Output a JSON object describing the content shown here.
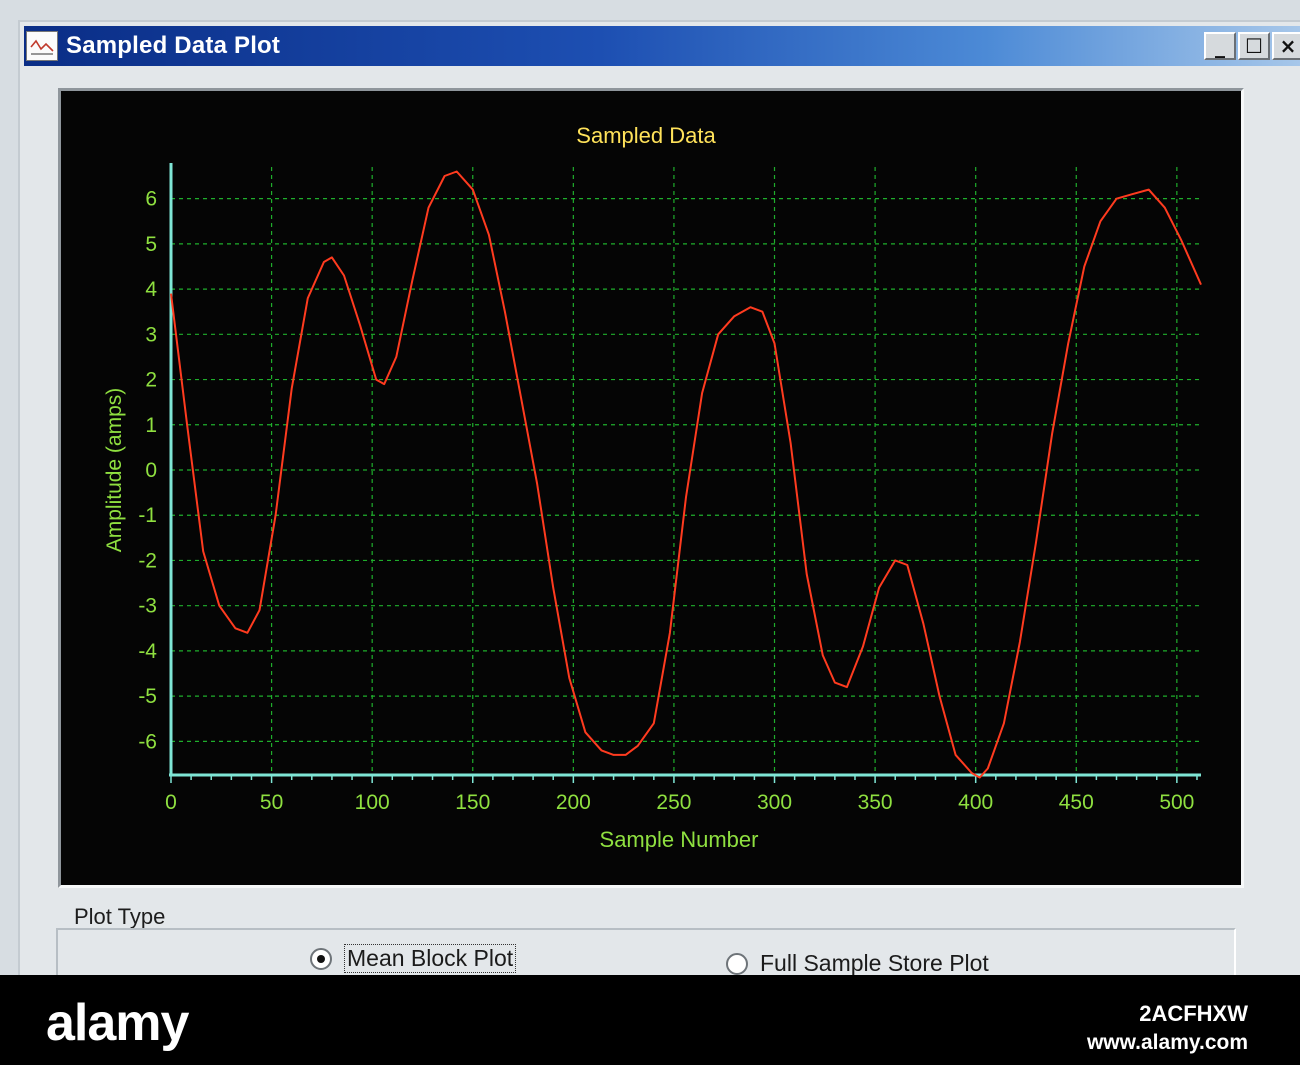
{
  "window": {
    "title": "Sampled Data Plot",
    "controls": {
      "minimize": "_",
      "maximize": "☐",
      "close": "×"
    }
  },
  "plot_type": {
    "group_label": "Plot Type",
    "options": [
      {
        "label": "Mean Block Plot",
        "selected": true
      },
      {
        "label": "Full Sample Store Plot",
        "selected": false
      }
    ]
  },
  "colors": {
    "plot_background": "#050505",
    "trace": "#ff3b1f",
    "grid": "#1fae2c",
    "axis_line": "#7fe6d6",
    "tick_label": "#8fe040",
    "title": "#ffe25a"
  },
  "chart_data": {
    "type": "line",
    "title": "Sampled Data",
    "xlabel": "Sample Number",
    "ylabel": "Amplitude (amps)",
    "xlim": [
      0,
      512
    ],
    "ylim": [
      -6.7,
      6.7
    ],
    "x_ticks": [
      0,
      50,
      100,
      150,
      200,
      250,
      300,
      350,
      400,
      450,
      500
    ],
    "y_ticks": [
      6,
      5,
      4,
      3,
      2,
      1,
      0,
      -1,
      -2,
      -3,
      -4,
      -5,
      -6
    ],
    "x_tick_labels": [
      "0",
      "50",
      "100",
      "150",
      "200",
      "250",
      "300",
      "350",
      "400",
      "450",
      "500"
    ],
    "y_tick_labels": [
      "6",
      "5",
      "4",
      "3",
      "2",
      "1",
      "0",
      "-1",
      "-2",
      "-3",
      "-4",
      "-5",
      "-6"
    ],
    "grid": true,
    "series": [
      {
        "x": [
          0,
          8,
          16,
          24,
          32,
          38,
          44,
          52,
          60,
          68,
          76,
          80,
          86,
          94,
          102,
          106,
          112,
          120,
          128,
          136,
          142,
          150,
          158,
          166,
          174,
          182,
          190,
          198,
          206,
          214,
          220,
          226,
          232,
          240,
          248,
          256,
          264,
          272,
          280,
          288,
          294,
          300,
          308,
          316,
          324,
          330,
          336,
          344,
          352,
          360,
          366,
          374,
          382,
          390,
          398,
          402,
          406,
          414,
          422,
          430,
          438,
          446,
          454,
          462,
          470,
          478,
          486,
          494,
          502,
          512
        ],
        "y": [
          3.9,
          1.0,
          -1.8,
          -3.0,
          -3.5,
          -3.6,
          -3.1,
          -1.0,
          1.8,
          3.8,
          4.6,
          4.7,
          4.3,
          3.2,
          2.0,
          1.9,
          2.5,
          4.2,
          5.8,
          6.5,
          6.6,
          6.2,
          5.2,
          3.5,
          1.6,
          -0.3,
          -2.6,
          -4.6,
          -5.8,
          -6.2,
          -6.3,
          -6.3,
          -6.1,
          -5.6,
          -3.6,
          -0.6,
          1.7,
          3.0,
          3.4,
          3.6,
          3.5,
          2.8,
          0.6,
          -2.3,
          -4.1,
          -4.7,
          -4.8,
          -3.9,
          -2.6,
          -2.0,
          -2.1,
          -3.4,
          -5.0,
          -6.3,
          -6.7,
          -6.8,
          -6.6,
          -5.6,
          -3.8,
          -1.6,
          0.8,
          2.8,
          4.5,
          5.5,
          6.0,
          6.1,
          6.2,
          5.8,
          5.1,
          4.1
        ]
      }
    ]
  },
  "footer": {
    "logo": "alamy",
    "image_id": "2ACFHXW",
    "url": "www.alamy.com"
  }
}
